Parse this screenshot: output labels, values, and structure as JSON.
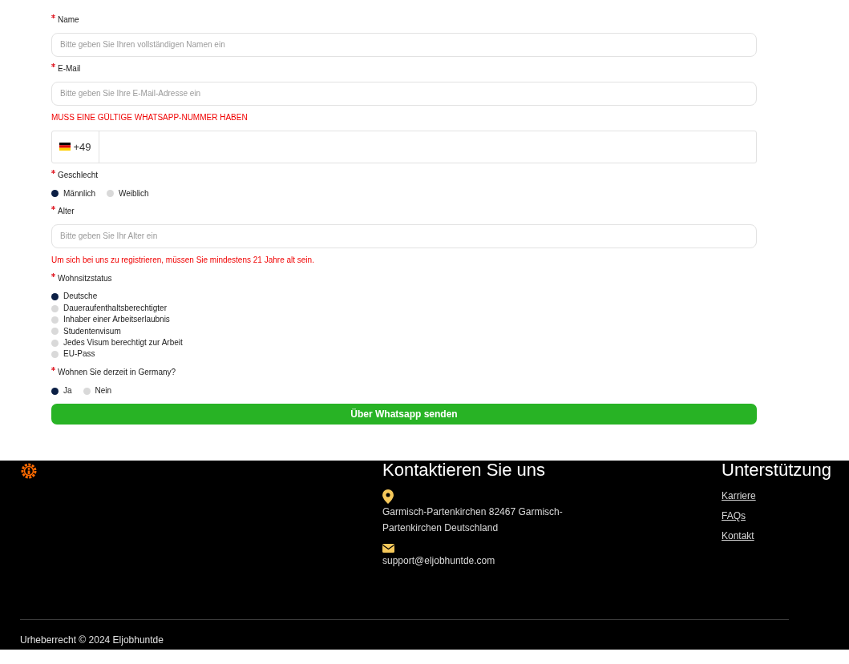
{
  "form": {
    "fields": [
      {
        "kind": "text",
        "label": "Name",
        "required": true,
        "placeholder": "Bitte geben Sie Ihren vollständigen Namen ein"
      },
      {
        "kind": "text",
        "label": "E-Mail",
        "required": true,
        "placeholder": "Bitte geben Sie Ihre E-Mail-Adresse ein"
      },
      {
        "kind": "notice",
        "text": "MUSS EINE GÜLTIGE WHATSAPP-NUMMER HABEN"
      },
      {
        "kind": "phone",
        "code": "+49"
      },
      {
        "kind": "radio_row",
        "label": "Geschlecht",
        "required": true,
        "options": [
          {
            "label": "Männlich",
            "selected": true
          },
          {
            "label": "Weiblich",
            "selected": false
          }
        ]
      },
      {
        "kind": "text",
        "label": "Alter",
        "required": true,
        "placeholder": "Bitte geben Sie Ihr Alter ein"
      },
      {
        "kind": "notice",
        "text": "Um sich bei uns zu registrieren, müssen Sie mindestens 21 Jahre alt sein."
      },
      {
        "kind": "radio_list",
        "label": "Wohnsitzstatus",
        "required": true,
        "options": [
          {
            "label": "Deutsche",
            "selected": true
          },
          {
            "label": "Daueraufenthaltsberechtigter",
            "selected": false
          },
          {
            "label": "Inhaber einer Arbeitserlaubnis",
            "selected": false
          },
          {
            "label": "Studentenvisum",
            "selected": false
          },
          {
            "label": "Jedes Visum berechtigt zur Arbeit",
            "selected": false
          },
          {
            "label": "EU-Pass",
            "selected": false
          }
        ]
      },
      {
        "kind": "radio_row",
        "label": "Wohnen Sie derzeit in Germany?",
        "required": true,
        "options": [
          {
            "label": "Ja",
            "selected": true
          },
          {
            "label": "Nein",
            "selected": false
          }
        ]
      }
    ],
    "submit": "Über Whatsapp senden"
  },
  "footer": {
    "contact": {
      "heading": "Kontaktieren Sie uns",
      "address": "Garmisch-Partenkirchen 82467 Garmisch-Partenkirchen Deutschland",
      "email": "support@eljobhuntde.com"
    },
    "support": {
      "heading": "Unterstützung",
      "links": [
        "Karriere",
        "FAQs",
        "Kontakt"
      ]
    },
    "copyright": "Urheberrecht © 2024 Eljobhuntde"
  }
}
